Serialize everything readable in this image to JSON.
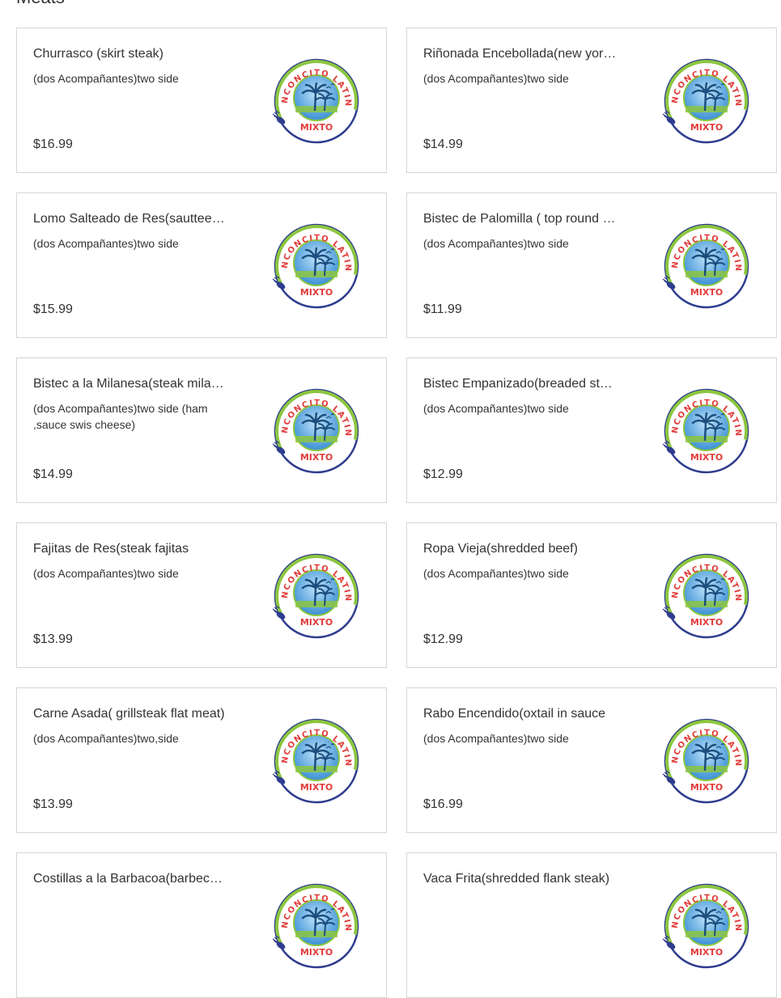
{
  "section": {
    "title": "Meats"
  },
  "logo_text": {
    "top": "RINCONCITO LATINO",
    "bottom": "MIXTO"
  },
  "colors": {
    "logo_green": "#8cc63f",
    "logo_red": "#e23b3b",
    "logo_blue": "#2e3d8f",
    "logo_sky": "#3a8fd4"
  },
  "items": [
    {
      "name": "Churrasco (skirt steak)",
      "desc": "(dos Acompañantes)two side",
      "price": "$16.99"
    },
    {
      "name": "Riñonada Encebollada(new york steak with onions)",
      "desc": "(dos Acompañantes)two side",
      "price": "$14.99"
    },
    {
      "name": "Lomo Salteado de Res(sauttee beef)",
      "desc": "(dos Acompañantes)two side",
      "price": "$15.99"
    },
    {
      "name": "Bistec de Palomilla ( top round steak)",
      "desc": "(dos Acompañantes)two side",
      "price": "$11.99"
    },
    {
      "name": "Bistec a la Milanesa(steak milanesa)",
      "desc": "(dos Acompañantes)two side (ham ,sauce swis cheese)",
      "price": "$14.99"
    },
    {
      "name": "Bistec Empanizado(breaded steak)",
      "desc": "(dos Acompañantes)two side",
      "price": "$12.99"
    },
    {
      "name": "Fajitas de Res(steak fajitas",
      "desc": "(dos Acompañantes)two side",
      "price": "$13.99"
    },
    {
      "name": "Ropa Vieja(shredded beef)",
      "desc": "(dos Acompañantes)two side",
      "price": "$12.99"
    },
    {
      "name": "Carne Asada( grillsteak flat meat)",
      "desc": "(dos Acompañantes)two,side",
      "price": "$13.99"
    },
    {
      "name": "Rabo Encendido(oxtail in sauce",
      "desc": "(dos Acompañantes)two side",
      "price": "$16.99"
    },
    {
      "name": "Costillas a la Barbacoa(barbecue ribs)",
      "desc": "",
      "price": ""
    },
    {
      "name": "Vaca Frita(shredded flank steak)",
      "desc": "",
      "price": ""
    }
  ]
}
